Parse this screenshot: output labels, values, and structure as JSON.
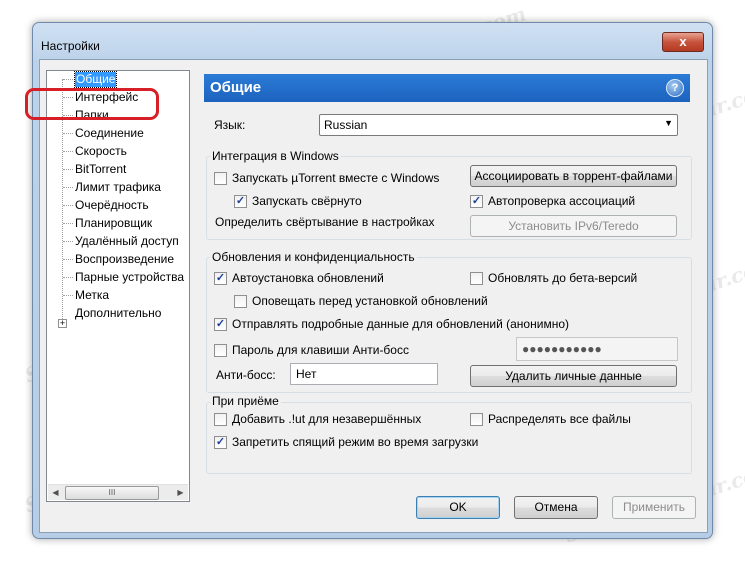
{
  "window": {
    "title": "Настройки",
    "close_label": "x"
  },
  "tree": {
    "items": [
      {
        "label": "Общие",
        "selected": true
      },
      {
        "label": "Интерфейс"
      },
      {
        "label": "Папки"
      },
      {
        "label": "Соединение"
      },
      {
        "label": "Скорость"
      },
      {
        "label": "BitTorrent"
      },
      {
        "label": "Лимит трафика"
      },
      {
        "label": "Очерёдность"
      },
      {
        "label": "Планировщик"
      },
      {
        "label": "Удалённый доступ"
      },
      {
        "label": "Воспроизведение"
      },
      {
        "label": "Парные устройства"
      },
      {
        "label": "Метка"
      },
      {
        "label": "Дополнительно"
      }
    ],
    "expander": "+",
    "scroll_left": "◀",
    "scroll_right": "▶",
    "scroll_grip": "III"
  },
  "panel": {
    "title": "Общие",
    "help": "?",
    "language_label": "Язык:",
    "language_value": "Russian",
    "windows_group": {
      "title": "Интеграция в Windows",
      "start_with_windows": {
        "label": "Запускать µTorrent вместе с Windows",
        "checked": false
      },
      "start_minimized": {
        "label": "Запускать свёрнуто",
        "checked": true
      },
      "minimize_note": "Определить свёртывание в настройках",
      "associate_button": "Ассоциировать в торрент-файлами",
      "auto_check_assoc": {
        "label": "Автопроверка ассоциаций",
        "checked": true
      },
      "ipv6_button": "Установить IPv6/Teredo"
    },
    "updates_group": {
      "title": "Обновления и конфиденциальность",
      "auto_install": {
        "label": "Автоустановка обновлений",
        "checked": true
      },
      "beta": {
        "label": "Обновлять до бета-версий",
        "checked": false
      },
      "notify_before": {
        "label": "Оповещать перед установкой обновлений",
        "checked": false
      },
      "send_details": {
        "label": "Отправлять подробные данные для обновлений (анонимно)",
        "checked": true
      },
      "boss_password": {
        "label": "Пароль для клавиши Анти-босс",
        "checked": false
      },
      "password_value": "●●●●●●●●●●●",
      "boss_key_label": "Анти-босс:",
      "boss_key_value": "Нет",
      "clear_private_button": "Удалить личные данные"
    },
    "receive_group": {
      "title": "При приёме",
      "add_ut": {
        "label": "Добавить .!ut для незавершённых",
        "checked": false
      },
      "preallocate": {
        "label": "Распределять все файлы",
        "checked": false
      },
      "prevent_sleep": {
        "label": "Запретить спящий режим во время загрузки",
        "checked": true
      }
    }
  },
  "buttons": {
    "ok": "OK",
    "cancel": "Отмена",
    "apply": "Применить"
  },
  "watermark": "Soringpcrepair.com",
  "check_glyph": "✓"
}
